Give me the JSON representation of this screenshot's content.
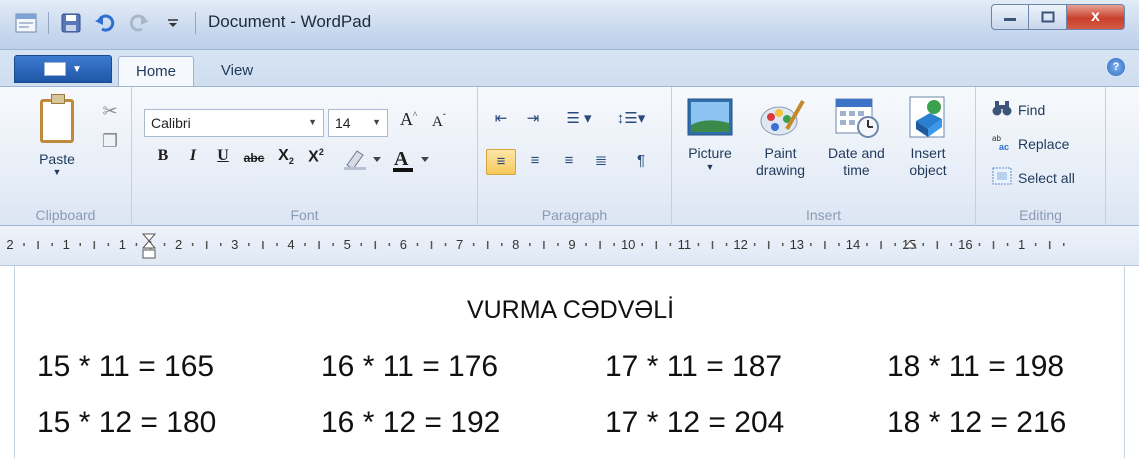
{
  "window": {
    "title": "Document - WordPad",
    "close_label": "x"
  },
  "tabs": [
    {
      "label": "Home"
    },
    {
      "label": "View"
    }
  ],
  "ribbon": {
    "clipboard": {
      "label": "Clipboard",
      "paste": "Paste"
    },
    "font": {
      "label": "Font",
      "family": "Calibri",
      "size": "14"
    },
    "paragraph": {
      "label": "Paragraph"
    },
    "insert": {
      "label": "Insert",
      "picture": "Picture",
      "paint_drawing": [
        "Paint",
        "drawing"
      ],
      "date_time": [
        "Date and",
        "time"
      ],
      "insert_object": [
        "Insert",
        "object"
      ]
    },
    "editing": {
      "label": "Editing",
      "find": "Find",
      "replace": "Replace",
      "select_all": "Select all"
    }
  },
  "ruler": {
    "numbers": [
      "2",
      "1",
      "1",
      "2",
      "3",
      "4",
      "5",
      "6",
      "7",
      "8",
      "9",
      "10",
      "11",
      "12",
      "13",
      "14",
      "15",
      "16",
      "1"
    ]
  },
  "document": {
    "heading": "VURMA CƏDVƏLİ",
    "rows": [
      [
        "15 * 11 = 165",
        "16 * 11 = 176",
        "17 * 11 = 187",
        "18 * 11 = 198"
      ],
      [
        "15 * 12 = 180",
        "16 * 12 = 192",
        "17 * 12 = 204",
        "18 * 12 = 216"
      ]
    ]
  }
}
